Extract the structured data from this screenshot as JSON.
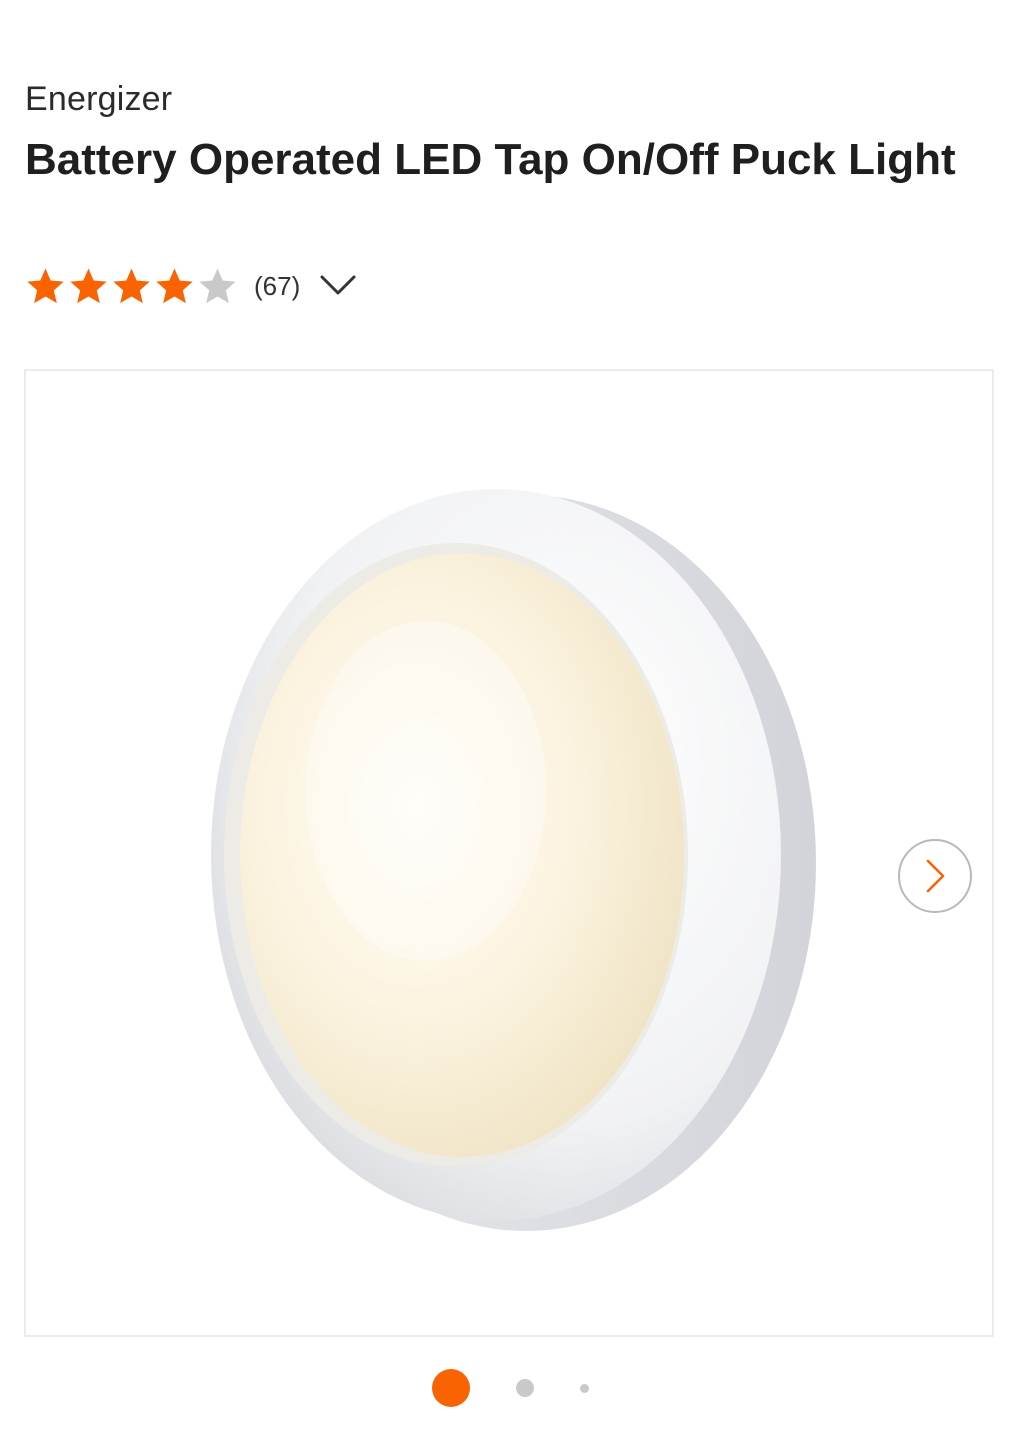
{
  "product": {
    "brand": "Energizer",
    "title": "Battery Operated LED Tap On/Off Puck Light",
    "rating": {
      "value": 4,
      "max": 5,
      "review_count": "(67)"
    }
  },
  "gallery": {
    "image_count": 3,
    "active_index": 0,
    "next_icon": "chevron-right-icon",
    "expand_icon": "chevron-down-icon"
  },
  "colors": {
    "accent": "#f96302",
    "star_filled": "#f96302",
    "star_empty": "#c9c9c9",
    "text": "#1f1f1f"
  }
}
